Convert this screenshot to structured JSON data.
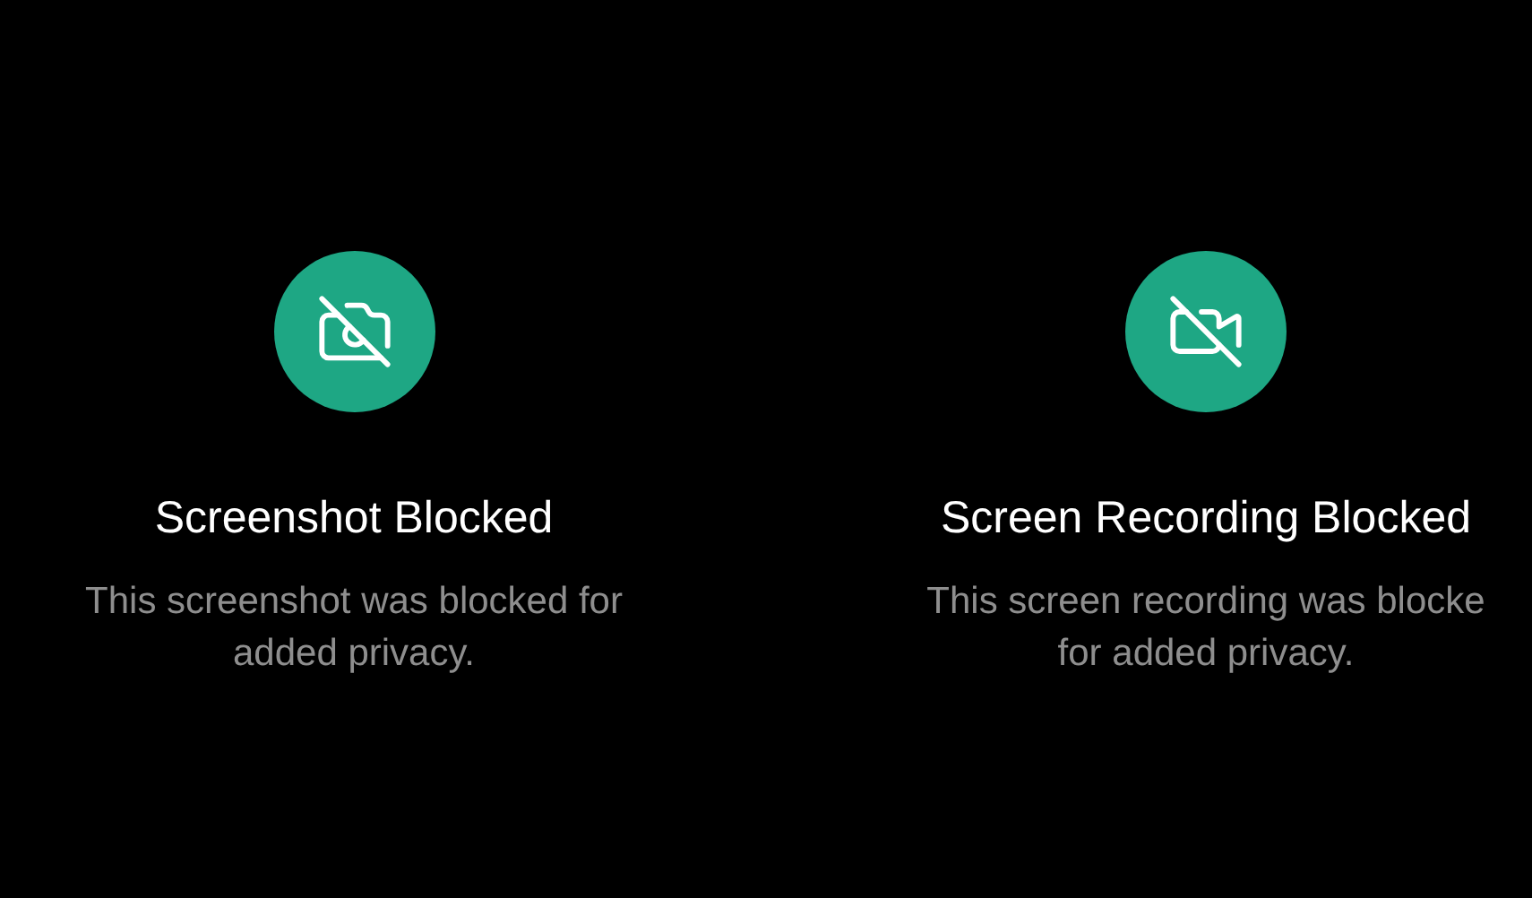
{
  "panels": [
    {
      "kind": "camera",
      "title": "Screenshot Blocked",
      "description": [
        "This screenshot was blocked for",
        "added privacy."
      ]
    },
    {
      "kind": "video",
      "title": "Screen Recording Blocked",
      "description": [
        "This screen recording was blocke",
        "for added privacy."
      ]
    }
  ]
}
